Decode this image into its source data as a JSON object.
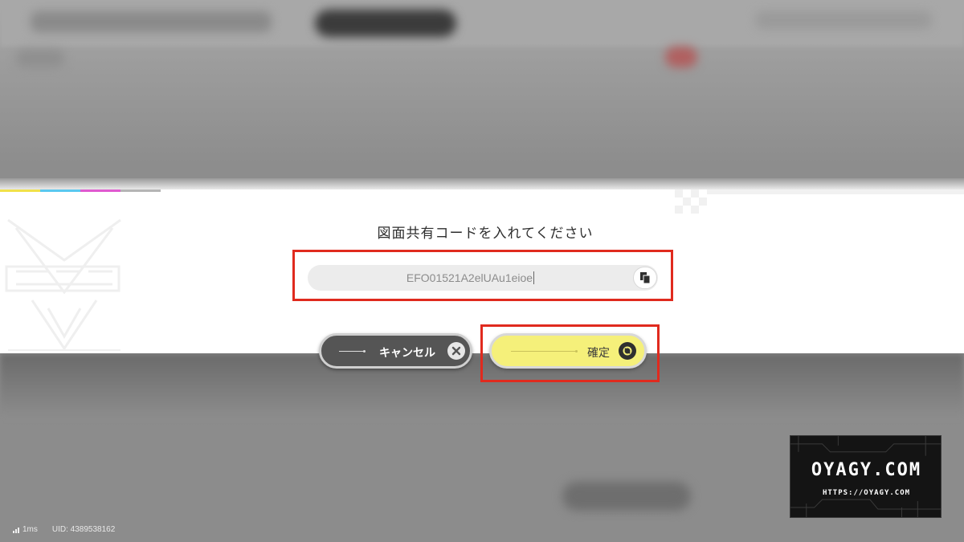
{
  "dialog": {
    "title": "図面共有コードを入れてください",
    "code_value": "EFO01521A2elUAu1eioe",
    "paste_icon": "paste-icon"
  },
  "buttons": {
    "cancel_label": "キャンセル",
    "cancel_icon": "close-icon",
    "confirm_label": "確定",
    "confirm_icon": "confirm-circle-icon"
  },
  "status_bar": {
    "ping": "1ms",
    "uid": "UID: 4389538162",
    "signal_icon": "signal-icon"
  },
  "watermark": {
    "title": "OYAGY.COM",
    "url": "HTTPS://OYAGY.COM"
  },
  "colors": {
    "highlight": "#e02a1e",
    "confirm_button": "#f5f07a",
    "cancel_button": "#555555",
    "dialog_background": "#ffffff"
  }
}
